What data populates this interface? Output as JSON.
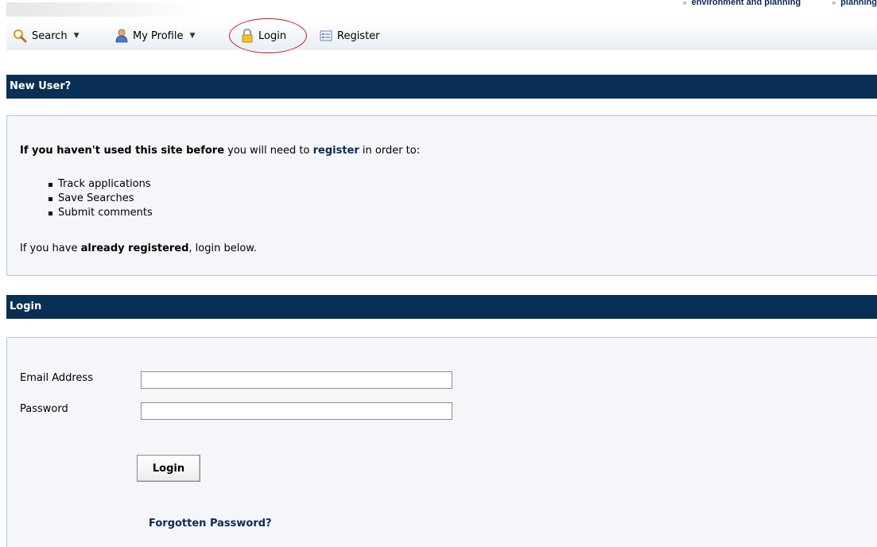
{
  "top_links": [
    "environment and planning",
    "planning"
  ],
  "toolbar": {
    "search": "Search",
    "my_profile": "My Profile",
    "login": "Login",
    "register": "Register"
  },
  "new_user": {
    "heading": "New User?",
    "intro_bold": "If you haven't used this site before",
    "intro_mid": " you will need to ",
    "register_link": "register",
    "intro_end": " in order to:",
    "bullets": [
      "Track applications",
      "Save Searches",
      "Submit comments"
    ],
    "already_pre": "If you have ",
    "already_bold": "already registered",
    "already_post": ", login below."
  },
  "login": {
    "heading": "Login",
    "email_label": "Email Address",
    "email_value": "",
    "password_label": "Password",
    "password_value": "",
    "button": "Login",
    "forgot": "Forgotten Password?"
  },
  "colors": {
    "header_bar": "#0a2f55",
    "panel_bg": "#f4f6fa",
    "link": "#0b2a57",
    "highlight_circle": "#d01818"
  }
}
